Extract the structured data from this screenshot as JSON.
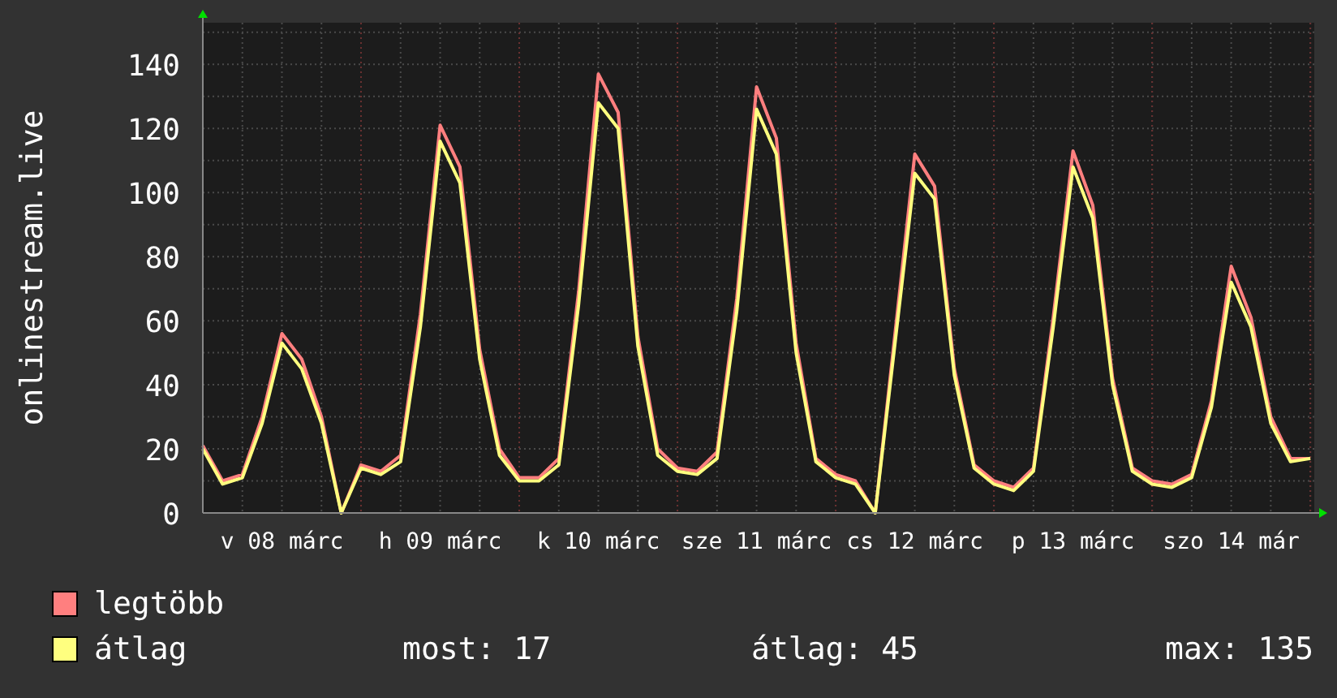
{
  "graph": {
    "chart_data": {
      "type": "line",
      "ylabel": "onlinestream.live",
      "categories": [
        null,
        null,
        null,
        null,
        "v 08 márc",
        null,
        null,
        null,
        null,
        null,
        null,
        null,
        "h 09 márc",
        null,
        null,
        null,
        null,
        null,
        null,
        null,
        "k 10 márc",
        null,
        null,
        null,
        null,
        null,
        null,
        null,
        "sze 11 márc",
        null,
        null,
        null,
        null,
        null,
        null,
        null,
        "cs 12 márc",
        null,
        null,
        null,
        null,
        null,
        null,
        null,
        "p 13 márc",
        null,
        null,
        null,
        null,
        null,
        null,
        null,
        "szo 14 már",
        null,
        null,
        null,
        null
      ],
      "ylim": [
        0,
        153
      ],
      "grid": true,
      "yticks": [
        0,
        20,
        40,
        60,
        80,
        100,
        120,
        140
      ],
      "series": [
        {
          "name": "legtöbb",
          "color": "#ff7f7f",
          "values": [
            21,
            10,
            12,
            30,
            56,
            48,
            30,
            0,
            15,
            13,
            18,
            62,
            121,
            108,
            51,
            20,
            11,
            11,
            17,
            69,
            137,
            125,
            55,
            20,
            14,
            13,
            19,
            67,
            133,
            117,
            53,
            17,
            12,
            10,
            0,
            56,
            112,
            102,
            45,
            15,
            10,
            8,
            14,
            61,
            113,
            96,
            42,
            14,
            10,
            9,
            12,
            35,
            77,
            61,
            30,
            17,
            17
          ]
        },
        {
          "name": "átlag",
          "color": "#ffff7f",
          "values": [
            20,
            9,
            11,
            28,
            53,
            45,
            28,
            0,
            14,
            12,
            16,
            58,
            116,
            103,
            48,
            18,
            10,
            10,
            15,
            65,
            128,
            120,
            52,
            18,
            13,
            12,
            17,
            63,
            126,
            112,
            50,
            16,
            11,
            9,
            0,
            53,
            106,
            98,
            43,
            14,
            9,
            7,
            13,
            58,
            108,
            92,
            40,
            13,
            9,
            8,
            11,
            33,
            72,
            58,
            28,
            16,
            17
          ]
        }
      ]
    }
  },
  "legend": {
    "stats": [
      {
        "label": "most: 17"
      },
      {
        "label": "átlag: 45"
      },
      {
        "label": "max: 135"
      }
    ]
  }
}
